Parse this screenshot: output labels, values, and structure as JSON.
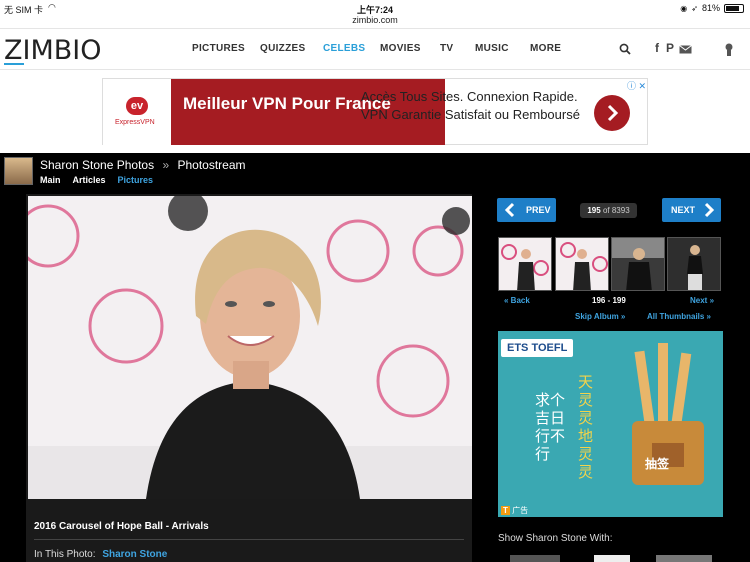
{
  "status": {
    "carrier": "无 SIM 卡",
    "time": "上午7:24",
    "battery": "81%",
    "battery_level": 0.81,
    "url": "zimbio.com"
  },
  "nav": {
    "logo": "ZIMBIO",
    "items": [
      "PICTURES",
      "QUIZZES",
      "CELEBS",
      "MOVIES",
      "TV",
      "MUSIC",
      "MORE"
    ],
    "active": "CELEBS",
    "icons": [
      "search-icon",
      "facebook-icon",
      "pinterest-icon",
      "mail-icon",
      "user-icon"
    ],
    "accent": "#2a9fd8"
  },
  "ad": {
    "brand": "ExpressVPN",
    "headline": "Meilleur VPN Pour France",
    "body": "Accès Tous Sites. Connexion Rapide. VPN Garantie Satisfait ou Remboursé",
    "color": "#a51c22"
  },
  "gallery": {
    "title": "Sharon Stone Photos",
    "separator": "»",
    "subtitle": "Photostream",
    "tabs": [
      "Main",
      "Articles",
      "Pictures"
    ],
    "active_tab": "Pictures",
    "prev": "PREV",
    "next": "NEXT",
    "current": "195",
    "of_label": "of",
    "total": "8393",
    "back": "« Back",
    "range": "196 - 199",
    "next_link": "Next »",
    "skip": "Skip Album »",
    "all_thumbs": "All Thumbnails »",
    "caption": "2016 Carousel of Hope Ball - Arrivals",
    "in_photo_label": "In This Photo:",
    "in_photo_name": "Sharon Stone",
    "show_with": "Show Sharon Stone With:"
  },
  "side_ad": {
    "brand": "ETS TOEFL",
    "line_right": "天灵灵 地灵灵",
    "line_left": "求个吉日 行不行",
    "badge": "抽签",
    "footer": "广告"
  }
}
